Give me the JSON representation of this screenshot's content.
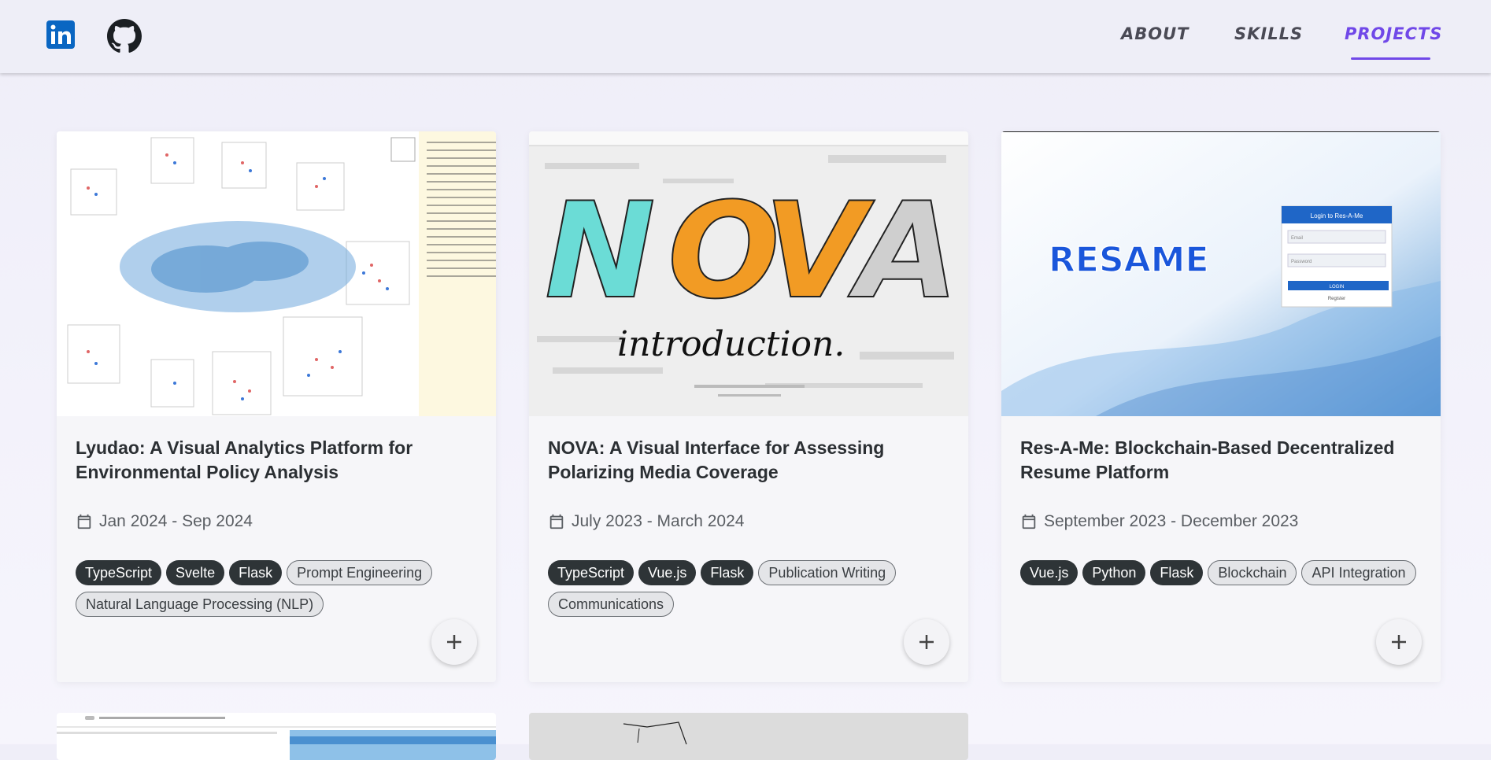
{
  "header": {
    "social": [
      {
        "name": "linkedin-icon",
        "label": "in",
        "color": "#0a66c2"
      },
      {
        "name": "github-icon"
      }
    ],
    "nav": [
      {
        "label": "ABOUT",
        "active": false
      },
      {
        "label": "SKILLS",
        "active": false
      },
      {
        "label": "PROJECTS",
        "active": true
      }
    ],
    "accent_color": "#7048e8"
  },
  "cards": [
    {
      "title": "Lyudao: A Visual Analytics Platform for Environmental Policy Analysis",
      "date": "Jan 2024 - Sep 2024",
      "tags": [
        "TypeScript",
        "Svelte",
        "Flask",
        "Prompt Engineering",
        "Natural Language Processing (NLP)"
      ],
      "tag_styles": [
        "dark",
        "dark",
        "dark",
        "light",
        "light"
      ],
      "image": "lyudao-visualization-screenshot"
    },
    {
      "title": "NOVA: A Visual Interface for Assessing Polarizing Media Coverage",
      "date": "July 2023 - March 2024",
      "tags": [
        "TypeScript",
        "Vue.js",
        "Flask",
        "Publication Writing",
        "Communications"
      ],
      "tag_styles": [
        "dark",
        "dark",
        "dark",
        "light",
        "light"
      ],
      "image": "nova-introduction-banner",
      "image_text": {
        "logo": "NOVA",
        "subtitle": "introduction."
      }
    },
    {
      "title": "Res-A-Me: Blockchain-Based Decentralized Resume Platform",
      "date": "September 2023 - December 2023",
      "tags": [
        "Vue.js",
        "Python",
        "Flask",
        "Blockchain",
        "API Integration"
      ],
      "tag_styles": [
        "dark",
        "dark",
        "dark",
        "light",
        "light"
      ],
      "image": "resame-login-screenshot",
      "image_text": {
        "logo": "RESAME",
        "login_title": "Login to Res-A-Me",
        "email_placeholder": "Email",
        "password_placeholder": "Password",
        "login_button": "LOGIN",
        "register_link": "Register"
      }
    }
  ]
}
